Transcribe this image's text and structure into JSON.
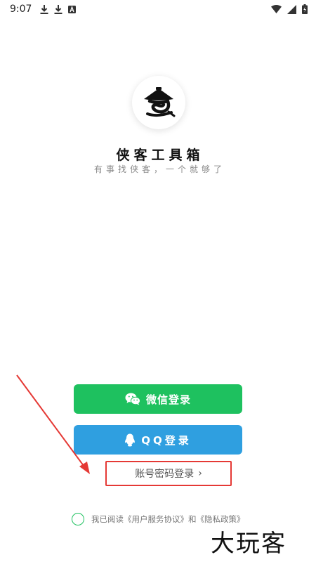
{
  "status_bar": {
    "time": "9:07",
    "left_icons": [
      "download-icon",
      "download-icon",
      "text-a-icon"
    ],
    "right_icons": [
      "wifi-icon",
      "signal-icon",
      "battery-charging-icon"
    ]
  },
  "app": {
    "logo_icon": "swordsman-hat-icon",
    "title": "侠客工具箱",
    "slogan": "有事找侠客，一个就够了"
  },
  "buttons": {
    "wechat": {
      "label": "微信登录",
      "icon": "wechat-icon",
      "color": "#1ec15f"
    },
    "qq": {
      "label": "QQ登录",
      "icon": "qq-penguin-icon",
      "color": "#2f9fe0"
    },
    "account": {
      "label": "账号密码登录",
      "arrow": "›"
    }
  },
  "agreement": {
    "prefix": "我已阅读",
    "user_agreement": "《用户服务协议》",
    "conjunction": "和",
    "privacy_policy": "《隐私政策》"
  },
  "annotation": {
    "color": "#e53935"
  },
  "watermark": {
    "text": "大玩客"
  }
}
